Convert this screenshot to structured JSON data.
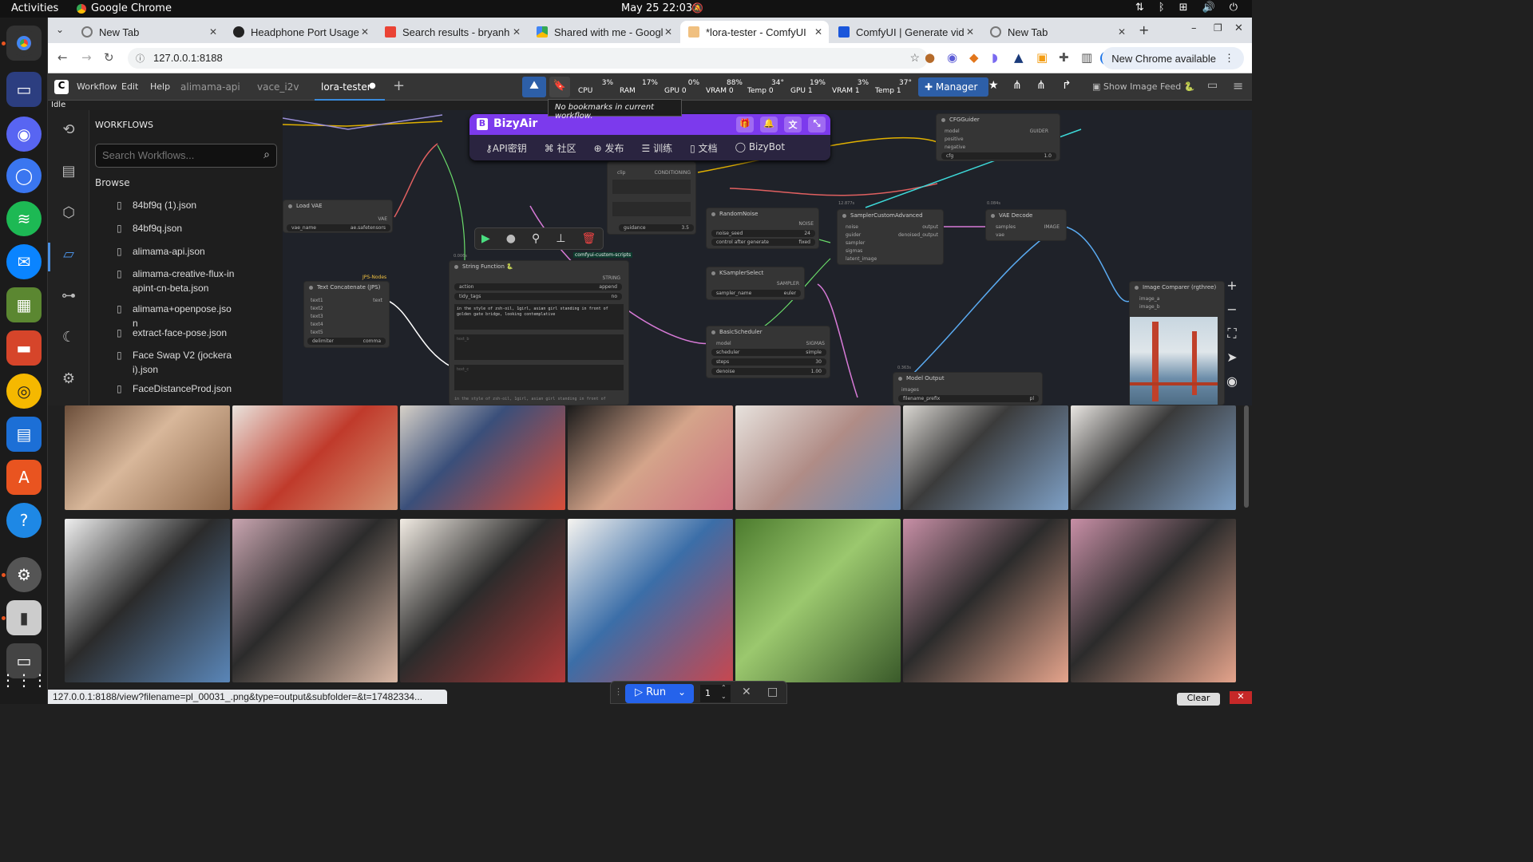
{
  "system": {
    "activities": "Activities",
    "app_name": "Google Chrome",
    "clock": "May 25  22:03"
  },
  "browser": {
    "tabs": [
      {
        "title": "New Tab"
      },
      {
        "title": "Headphone Port Usage"
      },
      {
        "title": "Search results - bryanh"
      },
      {
        "title": "Shared with me - Googl"
      },
      {
        "title": "*lora-tester - ComfyUI"
      },
      {
        "title": "ComfyUI | Generate vid"
      },
      {
        "title": "New Tab"
      }
    ],
    "url": "127.0.0.1:8188",
    "update_label": "New Chrome available"
  },
  "comfy": {
    "menus": [
      "Workflow",
      "Edit",
      "Help"
    ],
    "workflow_tabs": [
      "alimama-api",
      "vace_i2v",
      "lora-tester"
    ],
    "status": "Idle",
    "monitors": [
      {
        "label": "CPU",
        "value": "3%",
        "level": 0.03,
        "color": "#1c7e1c"
      },
      {
        "label": "RAM",
        "value": "17%",
        "level": 0.17,
        "color": "#1c7e1c"
      },
      {
        "label": "GPU 0",
        "value": "0%",
        "level": 0.0,
        "color": "#1c7e1c"
      },
      {
        "label": "VRAM 0",
        "value": "88%",
        "level": 0.88,
        "color": "#1a6fd6"
      },
      {
        "label": "Temp 0",
        "value": "34°",
        "level": 0.34,
        "color": "#37a62b"
      },
      {
        "label": "GPU 1",
        "value": "19%",
        "level": 0.19,
        "color": "#1c7e1c"
      },
      {
        "label": "VRAM 1",
        "value": "3%",
        "level": 0.03,
        "color": "#1a6fd6"
      },
      {
        "label": "Temp 1",
        "value": "37°",
        "level": 0.37,
        "color": "#37a62b"
      }
    ],
    "manager_label": "Manager",
    "image_feed_label": "Show Image Feed 🐍",
    "bookmark_tooltip": "No bookmarks in current workflow.",
    "run_label": "Run",
    "queue_count": "1",
    "clear_label": "Clear"
  },
  "workflows_panel": {
    "title": "WORKFLOWS",
    "search_placeholder": "Search Workflows...",
    "browse_label": "Browse",
    "files": [
      "84bf9q (1).json",
      "84bf9q.json",
      "alimama-api.json",
      "alimama-creative-flux-inapint-cn-beta.json",
      "alimama+openpose.json",
      "extract-face-pose.json",
      "Face Swap V2 (jockerai).json",
      "FaceDistanceProd.json"
    ]
  },
  "bizyair": {
    "title": "BizyAir",
    "nav": [
      "API密钥",
      "社区",
      "发布",
      "训练",
      "文档",
      "BizyBot"
    ]
  },
  "nodes": {
    "load_vae": {
      "title": "Load VAE",
      "vae_name": "vae_name",
      "vae_value": "ae.safetensors",
      "out": "VAE"
    },
    "text_concat": {
      "title": "Text Concatenate (JPS)",
      "badge": "JPS-Nodes",
      "inputs": [
        "text1",
        "text2",
        "text3",
        "text4",
        "text5"
      ],
      "out": "text",
      "delimiter": "delimiter",
      "delimiter_value": "comma"
    },
    "string_function": {
      "title": "String Function 🐍",
      "badge": "comfyui-custom-scripts",
      "out": "STRING",
      "action": "action",
      "action_value": "append",
      "tidy": "tidy_tags",
      "tidy_value": "no",
      "text_a": "in the style of zsh-oil, 1girl, asian girl standing in front of golden gate bridge, looking contemplative",
      "text_b": "text_b",
      "text_c": "text_c",
      "preview": "in the style of zsh-oil, 1girl, asian girl standing in front of",
      "timing": "0.006s"
    },
    "clip_encode": {
      "clip": "clip",
      "out": "CONDITIONING",
      "guidance": "guidance",
      "guidance_value": "3.5"
    },
    "random_noise": {
      "title": "RandomNoise",
      "out": "NOISE",
      "seed": "noise_seed",
      "seed_value": "24",
      "cag": "control after generate",
      "cag_value": "fixed"
    },
    "ksampler_select": {
      "title": "KSamplerSelect",
      "out": "SAMPLER",
      "name": "sampler_name",
      "value": "euler"
    },
    "basic_scheduler": {
      "title": "BasicScheduler",
      "in": "model",
      "out": "SIGMAS",
      "scheduler": "scheduler",
      "scheduler_value": "simple",
      "steps": "steps",
      "steps_value": "30",
      "denoise": "denoise",
      "denoise_value": "1.00"
    },
    "sampler_adv": {
      "title": "SamplerCustomAdvanced",
      "timing": "12.877s",
      "inputs": [
        "noise",
        "guider",
        "sampler",
        "sigmas",
        "latent_image"
      ],
      "out1": "output",
      "out2": "denoised_output"
    },
    "cfg_guider": {
      "title": "CFGGuider",
      "inputs": [
        "model",
        "positive",
        "negative"
      ],
      "out": "GUIDER",
      "cfg": "cfg",
      "cfg_value": "1.0"
    },
    "vae_decode": {
      "title": "VAE Decode",
      "timing": "0.084s",
      "in1": "samples",
      "in2": "vae",
      "out": "IMAGE"
    },
    "image_comparer": {
      "title": "Image Comparer (rgthree)",
      "in1": "image_a",
      "in2": "image_b"
    },
    "model_output": {
      "title": "Model Output",
      "timing": "0.363s",
      "in": "images",
      "prefix": "filename_prefix",
      "prefix_value": "pl"
    }
  },
  "status_bar_url": "127.0.0.1:8188/view?filename=pl_00031_.png&type=output&subfolder=&t=17482334..."
}
